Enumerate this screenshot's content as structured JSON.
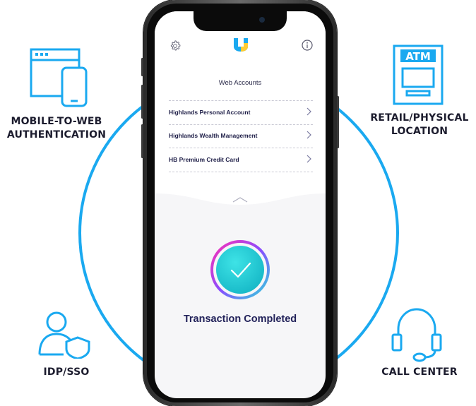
{
  "channels": {
    "mobile_to_web": {
      "line1": "MOBILE-TO-WEB",
      "line2": "AUTHENTICATION",
      "icon": "browser-phone-icon"
    },
    "retail": {
      "line1": "RETAIL/PHYSICAL",
      "line2": "LOCATION",
      "icon": "atm-icon",
      "atm_text": "ATM"
    },
    "idp": {
      "label": "IDP/SSO",
      "icon": "user-shield-icon"
    },
    "call_center": {
      "label": "CALL CENTER",
      "icon": "headset-icon"
    }
  },
  "app": {
    "header": {
      "settings_icon": "gear-icon",
      "logo_icon": "hypr-logo-icon",
      "info_icon": "info-icon"
    },
    "web_accounts": {
      "title": "Web Accounts",
      "items": [
        {
          "label": "Highlands Personal Account"
        },
        {
          "label": "Highlands Wealth Management"
        },
        {
          "label": "HB Premium Credit Card"
        }
      ]
    },
    "status": {
      "text": "Transaction Completed",
      "icon": "checkmark-icon"
    }
  },
  "colors": {
    "accent_blue": "#1aa9f0",
    "navy": "#22225a",
    "teal": "#2ed6dc",
    "pink": "#ff2fb3",
    "purple": "#8a4dff"
  }
}
